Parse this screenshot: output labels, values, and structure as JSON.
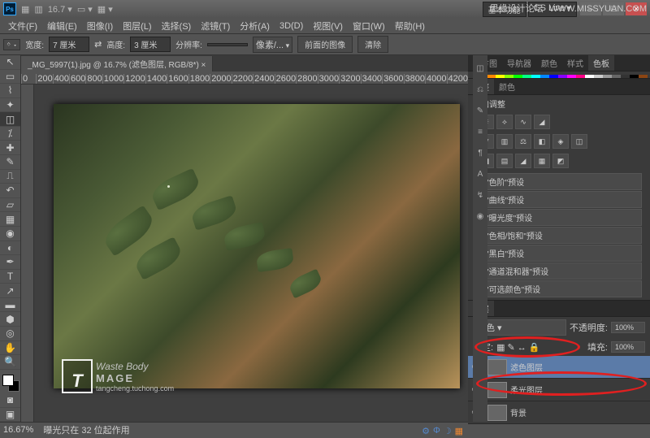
{
  "watermark_url_top": "WWW.MISSYUAN.COM",
  "watermark_forum": "思缘设计论坛",
  "titlebar": {
    "zoom": "16.7",
    "workspace_basic": "基本功能",
    "workspace_live": "CS Live"
  },
  "menus": [
    "文件(F)",
    "编辑(E)",
    "图像(I)",
    "图层(L)",
    "选择(S)",
    "滤镜(T)",
    "分析(A)",
    "3D(D)",
    "视图(V)",
    "窗口(W)",
    "帮助(H)"
  ],
  "options": {
    "width_lbl": "宽度:",
    "width_val": "7 厘米",
    "height_lbl": "高度:",
    "height_val": "3 厘米",
    "res_lbl": "分辨率:",
    "res_val": "",
    "res_unit": "像素/...",
    "front_btn": "前面的图像",
    "clear_btn": "清除"
  },
  "doc_tab": "_MG_5997(1).jpg @ 16.7% (滤色图层, RGB/8*) ×",
  "ruler_marks": [
    "0",
    "200",
    "400",
    "600",
    "800",
    "1000",
    "1200",
    "1400",
    "1600",
    "1800",
    "2000",
    "2200",
    "2400",
    "2600",
    "2800",
    "3000",
    "3200",
    "3400",
    "3600",
    "3800",
    "4000",
    "4200"
  ],
  "status": {
    "zoom": "16.67%",
    "info": "曝光只在 32 位起作用"
  },
  "panels": {
    "tabs1": [
      "直方图",
      "导航器",
      "颜色",
      "样式",
      "色板"
    ],
    "adj_tabs": [
      "调整",
      "颜色"
    ],
    "adj_title": "添加调整",
    "presets": [
      "\"色阶\"预设",
      "\"曲线\"预设",
      "\"曝光度\"预设",
      "\"色相/饱和\"预设",
      "\"黑白\"预设",
      "\"通道混和器\"预设",
      "\"可选颜色\"预设"
    ]
  },
  "layers": {
    "blend_lbl": "滤色",
    "opacity_lbl": "不透明度:",
    "opacity": "100%",
    "lock_lbl": "锁定:",
    "fill_lbl": "填充:",
    "fill": "100%",
    "items": [
      {
        "name": "滤色图层",
        "sel": true
      },
      {
        "name": "柔光图层",
        "sel": false
      },
      {
        "name": "背景",
        "sel": false
      }
    ]
  },
  "swatch_colors": [
    "#ff0000",
    "#ff8800",
    "#ffff00",
    "#88ff00",
    "#00ff00",
    "#00ff88",
    "#00ffff",
    "#0088ff",
    "#0000ff",
    "#8800ff",
    "#ff00ff",
    "#ff0088",
    "#fff",
    "#ccc",
    "#999",
    "#666",
    "#333",
    "#000",
    "#8b4513",
    "#a0522d",
    "#cd853f",
    "#d2691e",
    "#b8860b",
    "#daa520",
    "#ffd700",
    "#f0e68c",
    "#bdb76b",
    "#808000",
    "#556b2f",
    "#6b8e23",
    "#228b22",
    "#008000",
    "#2e8b57",
    "#3cb371",
    "#20b2aa",
    "#008080",
    "#4682b4",
    "#5f9ea0",
    "#6495ed",
    "#4169e1",
    "#191970",
    "#000080",
    "#483d8b",
    "#6a5acd",
    "#7b68ee",
    "#8a2be2",
    "#9400d3",
    "#9932cc",
    "#ba55d3",
    "#c71585",
    "#db7093",
    "#ffc0cb",
    "#ffb6c1",
    "#ff69b4",
    "#dc143c",
    "#b22222",
    "#8b0000",
    "#a52a2a",
    "#800000",
    "#696969",
    "#808080",
    "#a9a9a9",
    "#c0c0c0",
    "#d3d3d3",
    "#dcdcdc",
    "#f5f5f5",
    "#ffffff",
    "#ffe4e1",
    "#ffe4b5",
    "#fffacd",
    "#fafad2",
    "#f0fff0",
    "#f5fffa",
    "#f0ffff",
    "#e0ffff",
    "#e6e6fa",
    "#fff0f5",
    "#ffe4c4",
    "#ffdead",
    "#f5deb3",
    "#deb887",
    "#d2b48c",
    "#bc8f8f",
    "#f4a460",
    "#e9967a",
    "#fa8072",
    "#ffa07a",
    "#ff7f50",
    "#ff6347",
    "#ff4500"
  ],
  "watermark": {
    "letter": "T",
    "script": "Waste Body",
    "sub": "MAGE",
    "url": "tangcheng.tuchong.com"
  }
}
